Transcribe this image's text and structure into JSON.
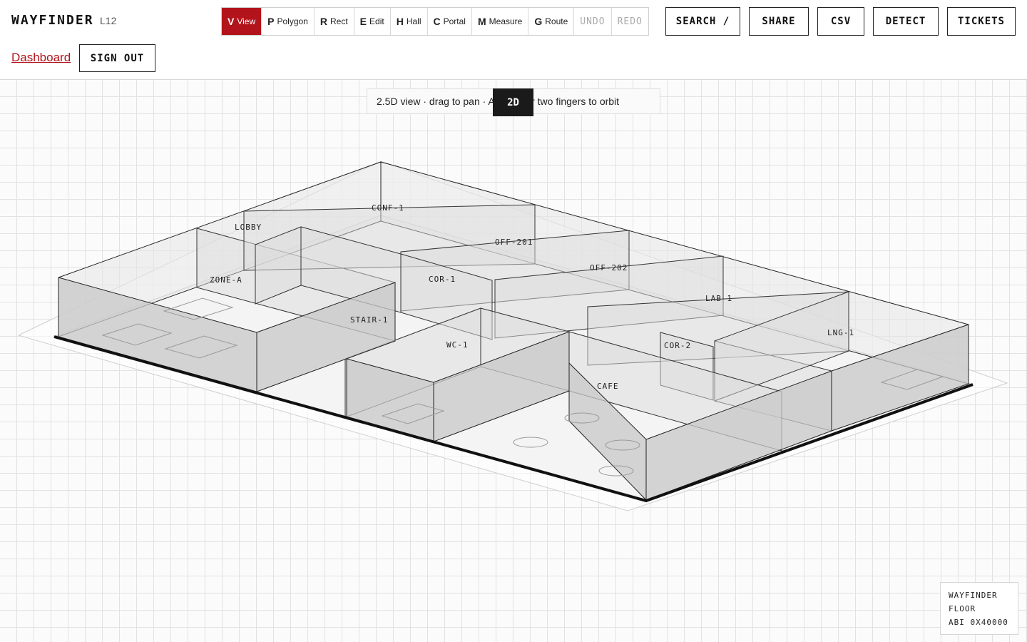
{
  "app": {
    "name": "WAYFINDER",
    "level": "L12"
  },
  "nav": {
    "dashboard_link": "Dashboard",
    "sign_out": "SIGN OUT"
  },
  "toolbar": {
    "tools": [
      {
        "key": "V",
        "label": "View",
        "active": true
      },
      {
        "key": "P",
        "label": "Polygon"
      },
      {
        "key": "R",
        "label": "Rect"
      },
      {
        "key": "E",
        "label": "Edit"
      },
      {
        "key": "H",
        "label": "Hall"
      },
      {
        "key": "C",
        "label": "Portal"
      },
      {
        "key": "M",
        "label": "Measure"
      },
      {
        "key": "G",
        "label": "Route"
      }
    ],
    "undo": "UNDO",
    "redo": "REDO"
  },
  "actions": {
    "search": "SEARCH /",
    "share": "SHARE",
    "csv": "CSV",
    "detect": "DETECT",
    "tickets": "TICKETS"
  },
  "viewport": {
    "hint": "2.5D view · drag to pan · Alt-drag or two fingers to orbit",
    "mode_toggle": "2D"
  },
  "rooms": [
    "CONF-1",
    "LOBBY",
    "OFF-201",
    "OFF-202",
    "ZONE-A",
    "COR-1",
    "LAB-1",
    "STAIR-1",
    "WC-1",
    "COR-2",
    "LNG-1",
    "CAFE"
  ],
  "info": {
    "line1": "WAYFINDER",
    "line2": "FLOOR",
    "line3": "ABI 0X40000"
  },
  "colors": {
    "accent": "#b3141b",
    "dark": "#1a1a1a"
  }
}
